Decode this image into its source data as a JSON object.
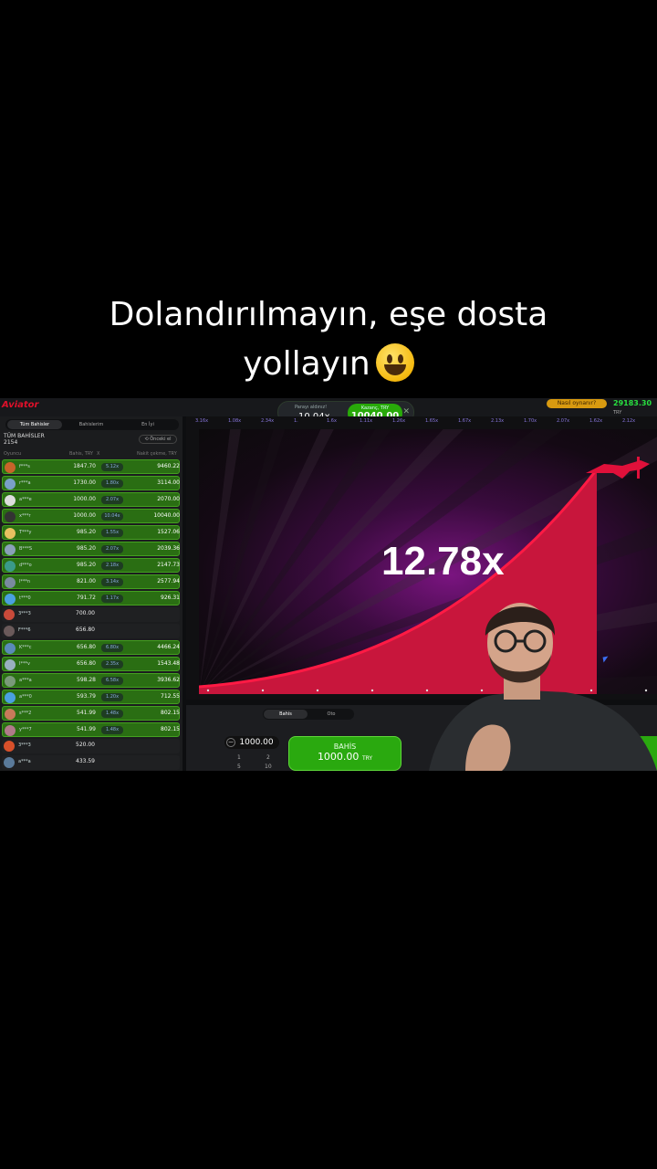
{
  "caption": {
    "line1": "Dolandırılmayın, eşe dosta",
    "line2": "yollayın",
    "emoji_icon": "grinning-face-emoji"
  },
  "header": {
    "logo": "Aviator",
    "cashout_label": "Parayı aldınız!",
    "cashout_multiplier": "10.04x",
    "win_label": "Kazanç, TRY",
    "win_value": "10040.00",
    "how_to_play": "Nasıl oynanır?",
    "balance": "29183.30",
    "currency": "TRY"
  },
  "left_panel": {
    "tabs": [
      "Tüm Bahisler",
      "Bahislerim",
      "En İyi"
    ],
    "all_bets_title": "TÜM BAHİSLER",
    "all_bets_count": "2154",
    "previous_button": "Önceki el",
    "columns": [
      "Oyuncu",
      "Bahis, TRY",
      "X",
      "Nakit çekme, TRY"
    ],
    "rows": [
      {
        "name": "f***s",
        "bet": "1847.70",
        "mult": "5.12x",
        "cash": "9460.22",
        "win": true,
        "color": "#c8642a"
      },
      {
        "name": "r***a",
        "bet": "1730.00",
        "mult": "1.80x",
        "cash": "3114.00",
        "win": true,
        "color": "#7aa0c8"
      },
      {
        "name": "a***e",
        "bet": "1000.00",
        "mult": "2.07x",
        "cash": "2070.00",
        "win": true,
        "color": "#dddddd"
      },
      {
        "name": "x***r",
        "bet": "1000.00",
        "mult": "10.04x",
        "cash": "10040.00",
        "win": true,
        "color": "#333333"
      },
      {
        "name": "T***y",
        "bet": "985.20",
        "mult": "1.55x",
        "cash": "1527.06",
        "win": true,
        "color": "#e8c060"
      },
      {
        "name": "B***S",
        "bet": "985.20",
        "mult": "2.07x",
        "cash": "2039.36",
        "win": true,
        "color": "#8aa0b8"
      },
      {
        "name": "d***o",
        "bet": "985.20",
        "mult": "2.18x",
        "cash": "2147.73",
        "win": true,
        "color": "#3a9a8a"
      },
      {
        "name": "l***n",
        "bet": "821.00",
        "mult": "3.14x",
        "cash": "2577.94",
        "win": true,
        "color": "#7a8aa0"
      },
      {
        "name": "t***0",
        "bet": "791.72",
        "mult": "1.17x",
        "cash": "926.31",
        "win": true,
        "color": "#4aa0e0"
      },
      {
        "name": "3***3",
        "bet": "700.00",
        "mult": "",
        "cash": "",
        "win": false,
        "color": "#c84a3a"
      },
      {
        "name": "F***6",
        "bet": "656.80",
        "mult": "",
        "cash": "",
        "win": false,
        "color": "#6a5a5a"
      },
      {
        "name": "K***c",
        "bet": "656.80",
        "mult": "6.80x",
        "cash": "4466.24",
        "win": true,
        "color": "#5a8ab8"
      },
      {
        "name": "I***v",
        "bet": "656.80",
        "mult": "2.35x",
        "cash": "1543.48",
        "win": true,
        "color": "#9ab0c0"
      },
      {
        "name": "a***a",
        "bet": "598.28",
        "mult": "6.58x",
        "cash": "3936.62",
        "win": true,
        "color": "#7a9a7a"
      },
      {
        "name": "a***0",
        "bet": "593.79",
        "mult": "1.20x",
        "cash": "712.55",
        "win": true,
        "color": "#4aa0e0"
      },
      {
        "name": "s***2",
        "bet": "541.99",
        "mult": "1.48x",
        "cash": "802.15",
        "win": true,
        "color": "#c87a5a"
      },
      {
        "name": "y***7",
        "bet": "541.99",
        "mult": "1.48x",
        "cash": "802.15",
        "win": true,
        "color": "#b07a8a"
      },
      {
        "name": "3***3",
        "bet": "520.00",
        "mult": "",
        "cash": "",
        "win": false,
        "color": "#d8502a"
      },
      {
        "name": "a***a",
        "bet": "433.59",
        "mult": "",
        "cash": "",
        "win": false,
        "color": "#5a7a9a"
      }
    ]
  },
  "history": [
    "3.16x",
    "1.08x",
    "2.34x",
    "1.",
    "1.6x",
    "1.11x",
    "1.26x",
    "1.65x",
    "1.67x",
    "2.13x",
    "1.70x",
    "2.07x",
    "1.62x",
    "2.12x"
  ],
  "game": {
    "multiplier": "12.78x",
    "accent": "#e0103a"
  },
  "bet_panel": {
    "tabs": [
      "Bahis",
      "Oto"
    ],
    "stake": "1000.00",
    "quick": [
      "1",
      "2",
      "5",
      "10"
    ],
    "bet_label": "BAHİS",
    "bet_amount": "1000.00",
    "bet_currency": "TRY"
  }
}
